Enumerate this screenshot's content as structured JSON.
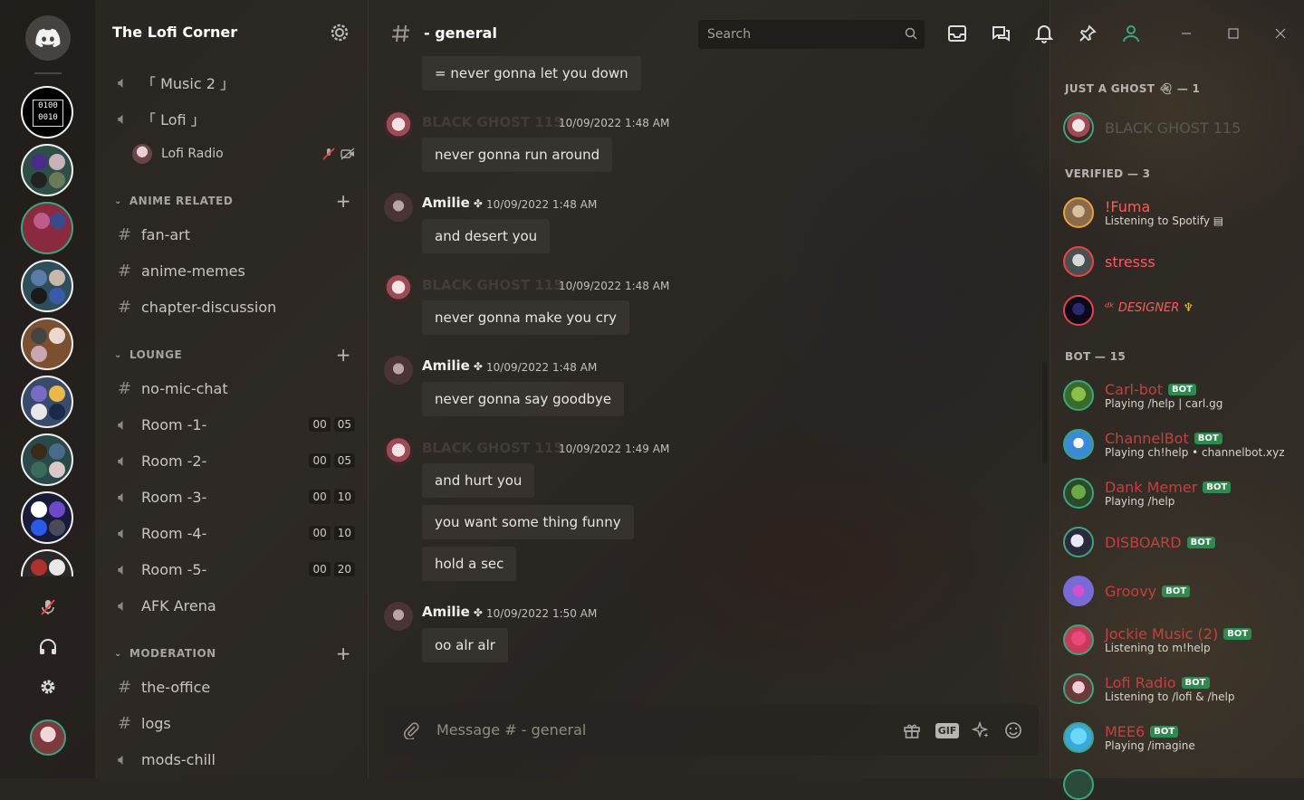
{
  "server": {
    "name": "The Lofi Corner"
  },
  "channels": {
    "top": [
      {
        "name": "「 Music 2 」",
        "kind": "voice"
      },
      {
        "name": "「 Lofi 」",
        "kind": "voice"
      }
    ],
    "voice_user": {
      "name": "Lofi Radio"
    },
    "categories": [
      {
        "name": "ANIME RELATED",
        "items": [
          {
            "name": "fan-art",
            "kind": "text"
          },
          {
            "name": "anime-memes",
            "kind": "text"
          },
          {
            "name": "chapter-discussion",
            "kind": "text"
          }
        ]
      },
      {
        "name": "LOUNGE",
        "items": [
          {
            "name": "no-mic-chat",
            "kind": "text"
          },
          {
            "name": "Room -1-",
            "kind": "voice",
            "timer": [
              "00",
              "05"
            ]
          },
          {
            "name": "Room -2-",
            "kind": "voice",
            "timer": [
              "00",
              "05"
            ]
          },
          {
            "name": "Room -3-",
            "kind": "voice",
            "timer": [
              "00",
              "10"
            ]
          },
          {
            "name": "Room -4-",
            "kind": "voice",
            "timer": [
              "00",
              "10"
            ]
          },
          {
            "name": "Room -5-",
            "kind": "voice",
            "timer": [
              "00",
              "20"
            ]
          },
          {
            "name": "AFK Arena",
            "kind": "voice"
          }
        ]
      },
      {
        "name": "MODERATION",
        "items": [
          {
            "name": "the-office",
            "kind": "text"
          },
          {
            "name": "logs",
            "kind": "text"
          },
          {
            "name": "mods-chill",
            "kind": "voice"
          }
        ]
      }
    ]
  },
  "chat": {
    "channel_title": "- general",
    "search_placeholder": "Search",
    "composer_placeholder": "Message # - general",
    "gif_label": "GIF",
    "messages": [
      {
        "text": "= never gonna let you down"
      },
      {
        "author": "BLACK GHOST 115",
        "time": "10/09/2022 1:48 AM",
        "text": "never gonna run around"
      },
      {
        "author": "Amilie",
        "badge": "✤",
        "time": "10/09/2022 1:48 AM",
        "text": "and desert you"
      },
      {
        "author": "BLACK GHOST 115",
        "time": "10/09/2022 1:48 AM",
        "text": "never gonna make you cry"
      },
      {
        "author": "Amilie",
        "badge": "✤",
        "time": "10/09/2022 1:48 AM",
        "text": "never gonna say goodbye"
      },
      {
        "author": "BLACK GHOST 115",
        "time": "10/09/2022 1:49 AM",
        "texts": [
          "and hurt you",
          "you want some thing funny",
          "hold a sec"
        ]
      },
      {
        "author": "Amilie",
        "badge": "✤",
        "time": "10/09/2022 1:50 AM",
        "text": "oo alr alr"
      }
    ]
  },
  "members": {
    "groups": [
      {
        "label": "JUST A GHOST",
        "count": "— 1",
        "members": [
          {
            "name": "BLACK GHOST 115",
            "color": "#5b5650"
          }
        ]
      },
      {
        "label": "VERIFIED",
        "count": "— 3",
        "members": [
          {
            "name": "!Fuma",
            "status": "Listening to Spotify",
            "color": "#ff5a5a"
          },
          {
            "name": "stresss",
            "color": "#ff5a5a"
          },
          {
            "name": "ᵈᵏ DESIGNER",
            "color": "#ff5a5a"
          }
        ]
      },
      {
        "label": "BOT",
        "count": "— 15",
        "members": [
          {
            "name": "Carl-bot",
            "status": "Playing /help | carl.gg",
            "color": "#c44040",
            "bot": "BOT"
          },
          {
            "name": "ChannelBot",
            "status": "Playing ch!help • channelbot.xyz",
            "color": "#c44040",
            "bot": "BOT"
          },
          {
            "name": "Dank Memer",
            "status": "Playing /help",
            "color": "#c44040",
            "bot": "BOT"
          },
          {
            "name": "DISBOARD",
            "color": "#c44040",
            "bot": "BOT"
          },
          {
            "name": "Groovy",
            "color": "#c44040",
            "bot": "BOT"
          },
          {
            "name": "Jockie Music (2)",
            "status": "Listening to m!help",
            "color": "#c44040",
            "bot": "BOT"
          },
          {
            "name": "Lofi Radio",
            "status": "Listening to /lofi & /help",
            "color": "#c44040",
            "bot": "BOT"
          },
          {
            "name": "MEE6",
            "status": "Playing /imagine",
            "color": "#c44040",
            "bot": "BOT"
          }
        ]
      }
    ]
  },
  "rail_servers": [
    "0100 0010"
  ]
}
